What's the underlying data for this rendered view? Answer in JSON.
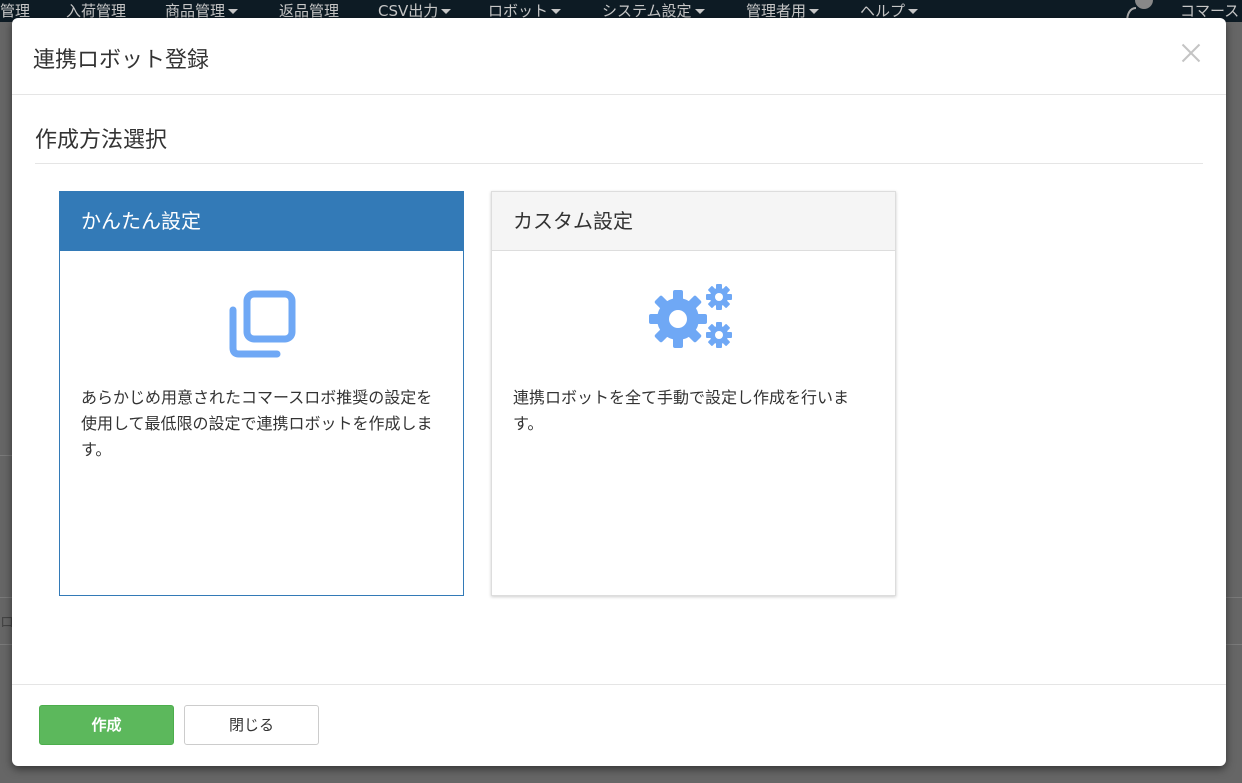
{
  "navbar": {
    "items": [
      {
        "label": "管理",
        "dropdown": false
      },
      {
        "label": "入荷管理",
        "dropdown": false
      },
      {
        "label": "商品管理",
        "dropdown": true
      },
      {
        "label": "返品管理",
        "dropdown": false
      },
      {
        "label": "CSV出力",
        "dropdown": true
      },
      {
        "label": "ロボット",
        "dropdown": true
      },
      {
        "label": "システム設定",
        "dropdown": true
      },
      {
        "label": "管理者用",
        "dropdown": true
      },
      {
        "label": "ヘルプ",
        "dropdown": true
      }
    ],
    "right_label": "コマース"
  },
  "background": {
    "partial_text": "ロ"
  },
  "modal": {
    "title": "連携ロボット登録",
    "section_title": "作成方法選択",
    "options": [
      {
        "title": "かんたん設定",
        "icon": "copy-icon",
        "description": "あらかじめ用意されたコマースロボ推奨の設定を使用して最低限の設定で連携ロボットを作成します。",
        "selected": true
      },
      {
        "title": "カスタム設定",
        "icon": "gears-icon",
        "description": "連携ロボットを全て手動で設定し作成を行います。",
        "selected": false
      }
    ],
    "buttons": {
      "create": "作成",
      "close": "閉じる"
    }
  },
  "colors": {
    "primary": "#337ab7",
    "success": "#5cb85c",
    "icon": "#6fa8f5"
  }
}
